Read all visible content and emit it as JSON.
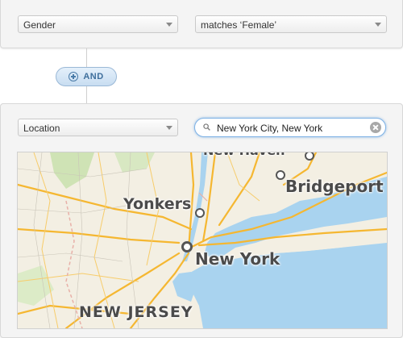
{
  "filter1": {
    "field": "Gender",
    "condition": "matches ‘Female’"
  },
  "operator": {
    "label": "AND",
    "icon": "plus-circle-icon"
  },
  "filter2": {
    "field": "Location",
    "search_value": "New York City, New York"
  },
  "map": {
    "labels": {
      "top_cut": "New Haven",
      "bridgeport": "Bridgeport",
      "yonkers": "Yonkers",
      "new_york": "New York",
      "new_jersey": "NEW JERSEY"
    }
  },
  "colors": {
    "accent": "#3f6f9c",
    "water": "#a9d3ef",
    "land": "#f3efe3",
    "roads": "#f5b731"
  }
}
